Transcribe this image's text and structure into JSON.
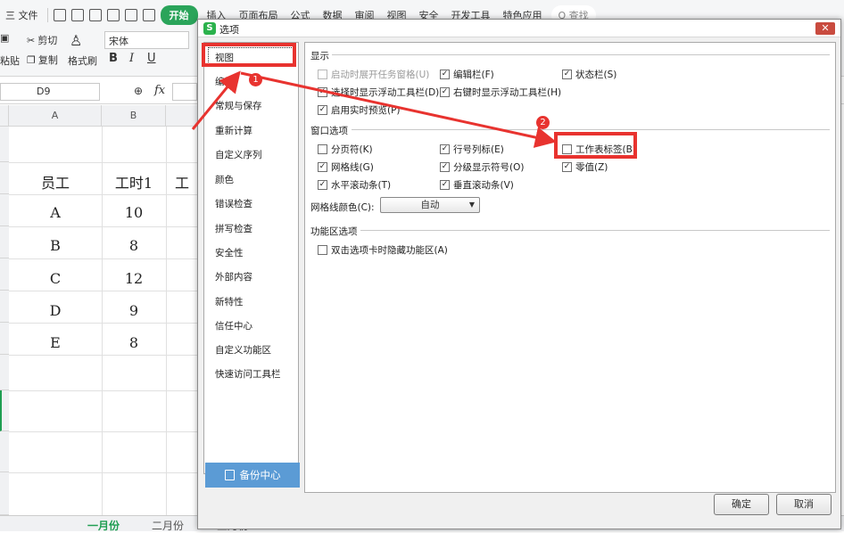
{
  "toolbar": {
    "file_menu": "三 文件",
    "tabs": [
      "开始",
      "插入",
      "页面布局",
      "公式",
      "数据",
      "审阅",
      "视图",
      "安全",
      "开发工具",
      "特色应用"
    ],
    "search_text": "Q 查找",
    "cut": "剪切",
    "copy": "复制",
    "paste": "粘贴",
    "format_painter": "格式刷",
    "font_name": "宋体",
    "format_buttons": [
      "B",
      "I",
      "U"
    ]
  },
  "formula_bar": {
    "name_box": "D9",
    "fx_label": "fx"
  },
  "sheet": {
    "columns": [
      "A",
      "B"
    ],
    "headers": [
      "员工",
      "工时1",
      "工"
    ],
    "rows": [
      [
        "A",
        "10"
      ],
      [
        "B",
        "8"
      ],
      [
        "C",
        "12"
      ],
      [
        "D",
        "9"
      ],
      [
        "E",
        "8"
      ]
    ]
  },
  "sheet_tabs": [
    "一月份",
    "二月份",
    "三月份"
  ],
  "dialog": {
    "title": "选项",
    "nav_items": [
      "视图",
      "编辑",
      "常规与保存",
      "重新计算",
      "自定义序列",
      "颜色",
      "错误检查",
      "拼写检查",
      "安全性",
      "外部内容",
      "新特性",
      "信任中心",
      "自定义功能区",
      "快速访问工具栏"
    ],
    "backup_button": "备份中心",
    "sections": {
      "display": "显示",
      "window_options": "窗口选项",
      "ribbon_options": "功能区选项"
    },
    "display_options": [
      {
        "label": "启动时展开任务窗格(U)",
        "checked": false,
        "disabled": true
      },
      {
        "label": "编辑栏(F)",
        "checked": true
      },
      {
        "label": "状态栏(S)",
        "checked": true
      },
      {
        "label": "选择时显示浮动工具栏(D)",
        "checked": true
      },
      {
        "label": "右键时显示浮动工具栏(H)",
        "checked": true
      },
      {
        "label": "启用实时预览(P)",
        "checked": true
      }
    ],
    "window_options": [
      {
        "label": "分页符(K)",
        "checked": false
      },
      {
        "label": "行号列标(E)",
        "checked": true
      },
      {
        "label": "工作表标签(B)",
        "checked": false
      },
      {
        "label": "网格线(G)",
        "checked": true
      },
      {
        "label": "分级显示符号(O)",
        "checked": true
      },
      {
        "label": "零值(Z)",
        "checked": true
      },
      {
        "label": "水平滚动条(T)",
        "checked": true
      },
      {
        "label": "垂直滚动条(V)",
        "checked": true
      }
    ],
    "gridline_color_label": "网格线颜色(C):",
    "gridline_color_value": "自动",
    "ribbon_option": {
      "label": "双击选项卡时隐藏功能区(A)",
      "checked": false
    },
    "ok_button": "确定",
    "cancel_button": "取消"
  },
  "annotations": {
    "marker1": "1",
    "marker2": "2",
    "highlight_color": "#e8332f"
  }
}
